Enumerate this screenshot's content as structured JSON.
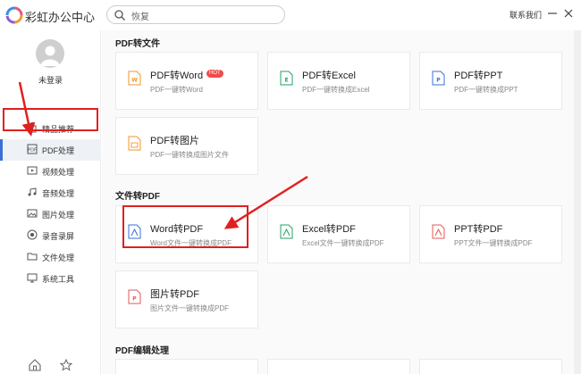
{
  "app": {
    "title": "彩虹办公中心",
    "accent": "#3a6fd8"
  },
  "search": {
    "value": "恢复"
  },
  "header": {
    "contact": "联系我们"
  },
  "user": {
    "login_label": "未登录"
  },
  "sidebar": {
    "items": [
      {
        "label": "精品推荐",
        "icon": "bag-icon"
      },
      {
        "label": "PDF处理",
        "icon": "pdf-icon"
      },
      {
        "label": "视频处理",
        "icon": "video-icon"
      },
      {
        "label": "音频处理",
        "icon": "audio-icon"
      },
      {
        "label": "图片处理",
        "icon": "image-icon"
      },
      {
        "label": "录音录屏",
        "icon": "record-icon"
      },
      {
        "label": "文件处理",
        "icon": "folder-icon"
      },
      {
        "label": "系统工具",
        "icon": "monitor-icon"
      }
    ],
    "active_index": 1
  },
  "sections": [
    {
      "title": "PDF转文件",
      "cards": [
        {
          "title": "PDF转Word",
          "desc": "PDF一键转Word",
          "badge": "HOT",
          "icon_letter": "W",
          "color": "#f0962b"
        },
        {
          "title": "PDF转Excel",
          "desc": "PDF一键转换成Excel",
          "icon_letter": "E",
          "color": "#21a366"
        },
        {
          "title": "PDF转PPT",
          "desc": "PDF一键转换成PPT",
          "icon_letter": "P",
          "color": "#3a6fd8"
        },
        {
          "title": "PDF转图片",
          "desc": "PDF一键转换成图片文件",
          "icon_letter": "▣",
          "color": "#f0962b"
        }
      ]
    },
    {
      "title": "文件转PDF",
      "cards": [
        {
          "title": "Word转PDF",
          "desc": "Word文件一键转换成PDF",
          "icon_letter": "A",
          "color": "#3a6fd8"
        },
        {
          "title": "Excel转PDF",
          "desc": "Excel文件一键转换成PDF",
          "icon_letter": "A",
          "color": "#21a366"
        },
        {
          "title": "PPT转PDF",
          "desc": "PPT文件一键转换成PDF",
          "icon_letter": "A",
          "color": "#e05a5a"
        },
        {
          "title": "图片转PDF",
          "desc": "图片文件一键转换成PDF",
          "icon_letter": "P",
          "color": "#e05a5a"
        }
      ]
    },
    {
      "title": "PDF编辑处理",
      "cards": []
    }
  ],
  "annotation_color": "#e02020"
}
